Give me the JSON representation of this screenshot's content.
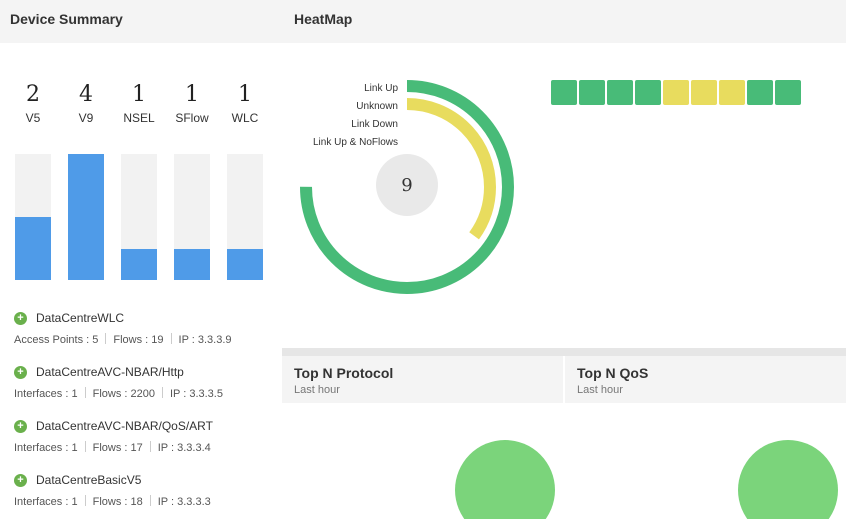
{
  "device_summary": {
    "title": "Device Summary",
    "counts": [
      {
        "value": "2",
        "label": "V5",
        "fill_fraction": 0.5
      },
      {
        "value": "4",
        "label": "V9",
        "fill_fraction": 1.0
      },
      {
        "value": "1",
        "label": "NSEL",
        "fill_fraction": 0.25
      },
      {
        "value": "1",
        "label": "SFlow",
        "fill_fraction": 0.25
      },
      {
        "value": "1",
        "label": "WLC",
        "fill_fraction": 0.25
      }
    ],
    "bar_color": "#4f9be8",
    "devices": [
      {
        "name": "DataCentreWLC",
        "meta": [
          "Access Points : 5",
          "Flows : 19",
          "IP : 3.3.3.9"
        ]
      },
      {
        "name": "DataCentreAVC-NBAR/Http",
        "meta": [
          "Interfaces : 1",
          "Flows : 2200",
          "IP : 3.3.3.5"
        ]
      },
      {
        "name": "DataCentreAVC-NBAR/QoS/ART",
        "meta": [
          "Interfaces : 1",
          "Flows : 17",
          "IP : 3.3.3.4"
        ]
      },
      {
        "name": "DataCentreBasicV5",
        "meta": [
          "Interfaces : 1",
          "Flows : 18",
          "IP : 3.3.3.3"
        ]
      }
    ]
  },
  "heatmap": {
    "title": "HeatMap",
    "total": "9",
    "legend": [
      "Link Up",
      "Unknown",
      "Link Down",
      "Link Up & NoFlows"
    ],
    "rings": [
      {
        "status": "Link Up",
        "fraction": 0.75,
        "color": "#48bb78"
      },
      {
        "status": "Unknown",
        "fraction": 0.35,
        "color": "#e8dc5e"
      }
    ],
    "cells": [
      "#48bb78",
      "#48bb78",
      "#48bb78",
      "#48bb78",
      "#e8dc5e",
      "#e8dc5e",
      "#e8dc5e",
      "#48bb78",
      "#48bb78"
    ]
  },
  "widgets": [
    {
      "title": "Top N Protocol",
      "subtitle": "Last hour"
    },
    {
      "title": "Top N QoS",
      "subtitle": "Last hour"
    }
  ]
}
